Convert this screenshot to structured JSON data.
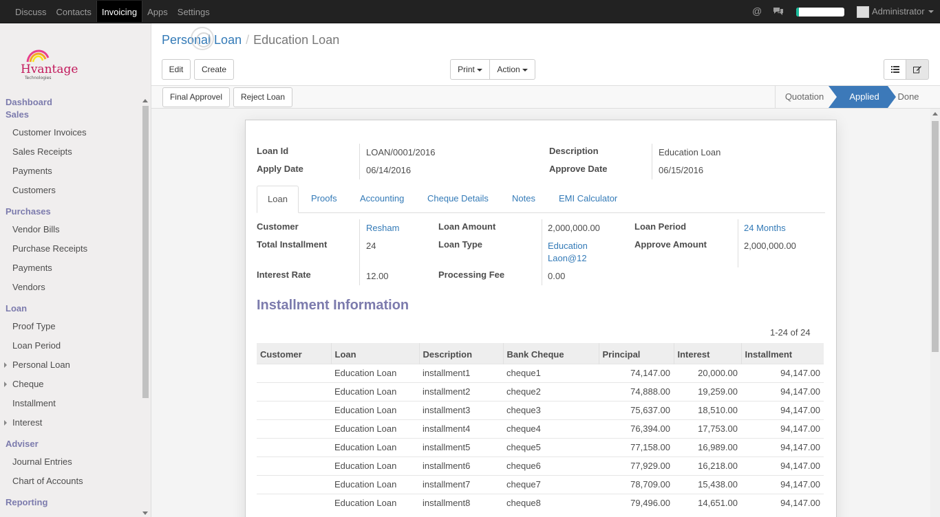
{
  "topbar": {
    "menu": [
      "Discuss",
      "Contacts",
      "Invoicing",
      "Apps",
      "Settings"
    ],
    "active": "Invoicing",
    "user": "Administrator",
    "progress": 0.05
  },
  "sidebar": {
    "sections": [
      {
        "title": "Dashboard"
      },
      {
        "title": "Sales",
        "items": [
          "Customer Invoices",
          "Sales Receipts",
          "Payments",
          "Customers"
        ]
      },
      {
        "title": "Purchases",
        "items": [
          "Vendor Bills",
          "Purchase Receipts",
          "Payments",
          "Vendors"
        ]
      },
      {
        "title": "Loan",
        "items": [
          "Proof Type",
          "Loan Period",
          "Personal Loan",
          "Cheque",
          "Installment",
          "Interest"
        ]
      },
      {
        "title": "Adviser",
        "items": [
          "Journal Entries",
          "Chart of Accounts"
        ]
      },
      {
        "title": "Reporting"
      }
    ]
  },
  "breadcrumb": {
    "parent": "Personal Loan",
    "separator": "/",
    "current": "Education Loan"
  },
  "buttons": {
    "edit": "Edit",
    "create": "Create",
    "print": "Print",
    "action": "Action",
    "final_approvel": "Final Approvel",
    "reject_loan": "Reject Loan"
  },
  "stages": [
    "Quotation",
    "Applied",
    "Done"
  ],
  "active_stage": "Applied",
  "header_fields": {
    "loan_id_label": "Loan Id",
    "loan_id": "LOAN/0001/2016",
    "apply_date_label": "Apply Date",
    "apply_date": "06/14/2016",
    "description_label": "Description",
    "description": "Education Loan",
    "approve_date_label": "Approve Date",
    "approve_date": "06/15/2016"
  },
  "tabs": [
    "Loan",
    "Proofs",
    "Accounting",
    "Cheque Details",
    "Notes",
    "EMI Calculator"
  ],
  "loan": {
    "customer_label": "Customer",
    "customer": "Resham",
    "total_installment_label": "Total Installment",
    "total_installment": "24",
    "interest_rate_label": "Interest Rate",
    "interest_rate": "12.00",
    "loan_amount_label": "Loan Amount",
    "loan_amount": "2,000,000.00",
    "loan_type_label": "Loan Type",
    "loan_type_1": "Education",
    "loan_type_2": "Laon@12",
    "processing_fee_label": "Processing Fee",
    "processing_fee": "0.00",
    "loan_period_label": "Loan Period",
    "loan_period": "24 Months",
    "approve_amount_label": "Approve Amount",
    "approve_amount": "2,000,000.00"
  },
  "installment": {
    "title": "Installment Information",
    "pager": "1-24 of 24",
    "columns": [
      "Customer",
      "Loan",
      "Description",
      "Bank Cheque",
      "Principal",
      "Interest",
      "Installment"
    ],
    "rows": [
      [
        "",
        "Education Loan",
        "installment1",
        "cheque1",
        "74,147.00",
        "20,000.00",
        "94,147.00"
      ],
      [
        "",
        "Education Loan",
        "installment2",
        "cheque2",
        "74,888.00",
        "19,259.00",
        "94,147.00"
      ],
      [
        "",
        "Education Loan",
        "installment3",
        "cheque3",
        "75,637.00",
        "18,510.00",
        "94,147.00"
      ],
      [
        "",
        "Education Loan",
        "installment4",
        "cheque4",
        "76,394.00",
        "17,753.00",
        "94,147.00"
      ],
      [
        "",
        "Education Loan",
        "installment5",
        "cheque5",
        "77,158.00",
        "16,989.00",
        "94,147.00"
      ],
      [
        "",
        "Education Loan",
        "installment6",
        "cheque6",
        "77,929.00",
        "16,218.00",
        "94,147.00"
      ],
      [
        "",
        "Education Loan",
        "installment7",
        "cheque7",
        "78,709.00",
        "15,438.00",
        "94,147.00"
      ],
      [
        "",
        "Education Loan",
        "installment8",
        "cheque8",
        "79,496.00",
        "14,651.00",
        "94,147.00"
      ]
    ]
  },
  "colors": {
    "accent": "#7c7bad",
    "link": "#337ab7",
    "active_stage": "#3c79b9",
    "topbar": "#222222"
  }
}
